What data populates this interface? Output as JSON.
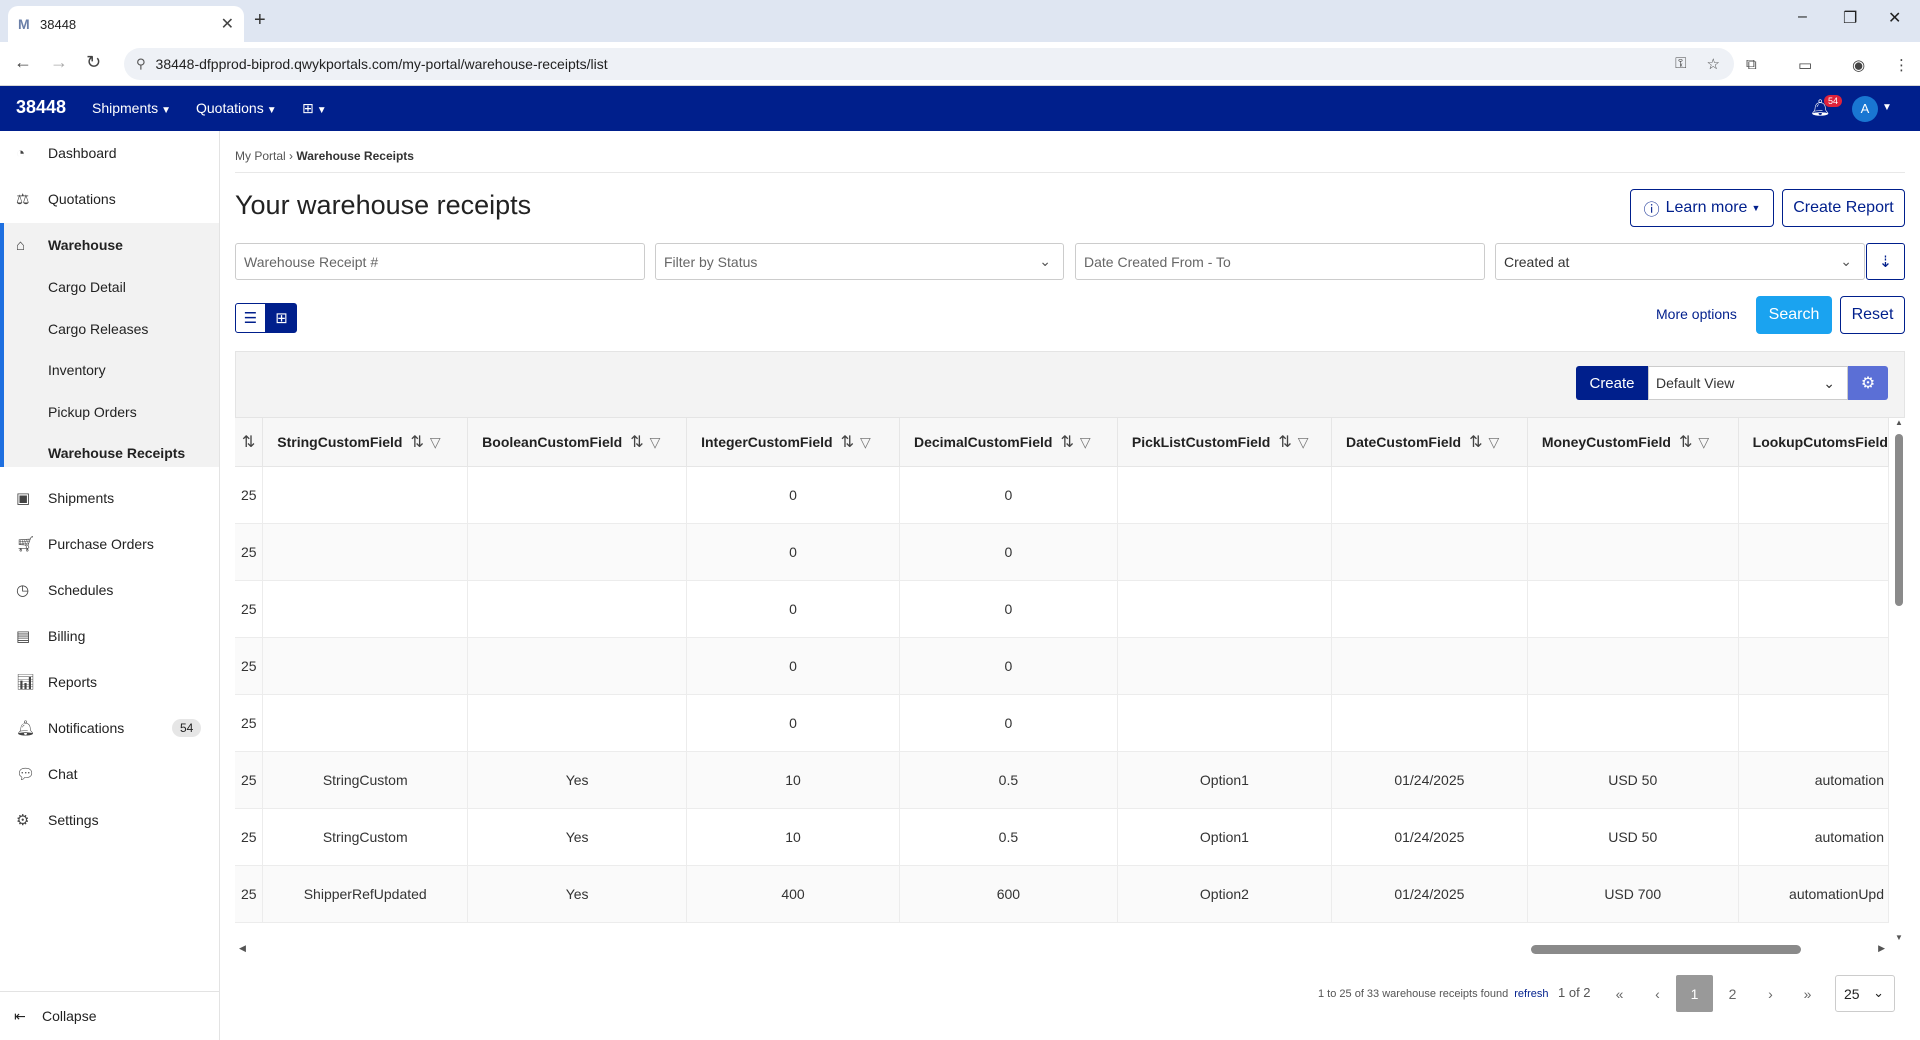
{
  "browser": {
    "tab_title": "38448",
    "tab_favicon": "M",
    "url": "38448-dfpprod-biprod.qwykportals.com/my-portal/warehouse-receipts/list"
  },
  "header": {
    "brand": "38448",
    "menus": [
      "Shipments",
      "Quotations"
    ],
    "notification_badge": "54",
    "avatar_initial": "A"
  },
  "sidebar": {
    "items": [
      {
        "label": "Dashboard",
        "icon": "dashboard-icon"
      },
      {
        "label": "Quotations",
        "icon": "quotations-icon"
      },
      {
        "label": "Warehouse",
        "icon": "warehouse-icon"
      },
      {
        "label": "Shipments",
        "icon": "shipments-icon"
      },
      {
        "label": "Purchase Orders",
        "icon": "cart-icon"
      },
      {
        "label": "Schedules",
        "icon": "clock-icon"
      },
      {
        "label": "Billing",
        "icon": "billing-icon"
      },
      {
        "label": "Reports",
        "icon": "chart-icon"
      },
      {
        "label": "Notifications",
        "icon": "bell-icon",
        "badge": "54"
      },
      {
        "label": "Chat",
        "icon": "chat-icon"
      },
      {
        "label": "Settings",
        "icon": "gear-icon"
      }
    ],
    "warehouse_sub": [
      "Cargo Detail",
      "Cargo Releases",
      "Inventory",
      "Pickup Orders",
      "Warehouse Receipts"
    ],
    "collapse_label": "Collapse"
  },
  "breadcrumb": {
    "root": "My Portal",
    "current": "Warehouse Receipts"
  },
  "page": {
    "title": "Your warehouse receipts",
    "learn_more": "Learn more",
    "create_report": "Create Report"
  },
  "filters": {
    "receipt_placeholder": "Warehouse Receipt #",
    "status_placeholder": "Filter by Status",
    "date_placeholder": "Date Created From - To",
    "sort_value": "Created at",
    "more_options": "More options",
    "search": "Search",
    "reset": "Reset"
  },
  "grid": {
    "create": "Create",
    "view": "Default View",
    "columns": [
      "StringCustomField",
      "BooleanCustomField",
      "IntegerCustomField",
      "DecimalCustomField",
      "PickListCustomField",
      "DateCustomField",
      "MoneyCustomField",
      "LookupCutomsField"
    ],
    "rows": [
      [
        "25",
        "",
        "",
        "0",
        "0",
        "",
        "",
        "",
        ""
      ],
      [
        "25",
        "",
        "",
        "0",
        "0",
        "",
        "",
        "",
        ""
      ],
      [
        "25",
        "",
        "",
        "0",
        "0",
        "",
        "",
        "",
        ""
      ],
      [
        "25",
        "",
        "",
        "0",
        "0",
        "",
        "",
        "",
        ""
      ],
      [
        "25",
        "",
        "",
        "0",
        "0",
        "",
        "",
        "",
        ""
      ],
      [
        "25",
        "StringCustom",
        "Yes",
        "10",
        "0.5",
        "Option1",
        "01/24/2025",
        "USD 50",
        "automation"
      ],
      [
        "25",
        "StringCustom",
        "Yes",
        "10",
        "0.5",
        "Option1",
        "01/24/2025",
        "USD 50",
        "automation"
      ],
      [
        "25",
        "ShipperRefUpdated",
        "Yes",
        "400",
        "600",
        "Option2",
        "01/24/2025",
        "USD 700",
        "automationUpd"
      ]
    ]
  },
  "pager": {
    "info": "1 to 25 of 33 warehouse receipts found",
    "refresh": "refresh",
    "page_of": "1 of 2",
    "current_page": "1",
    "next_page": "2",
    "page_size": "25"
  }
}
